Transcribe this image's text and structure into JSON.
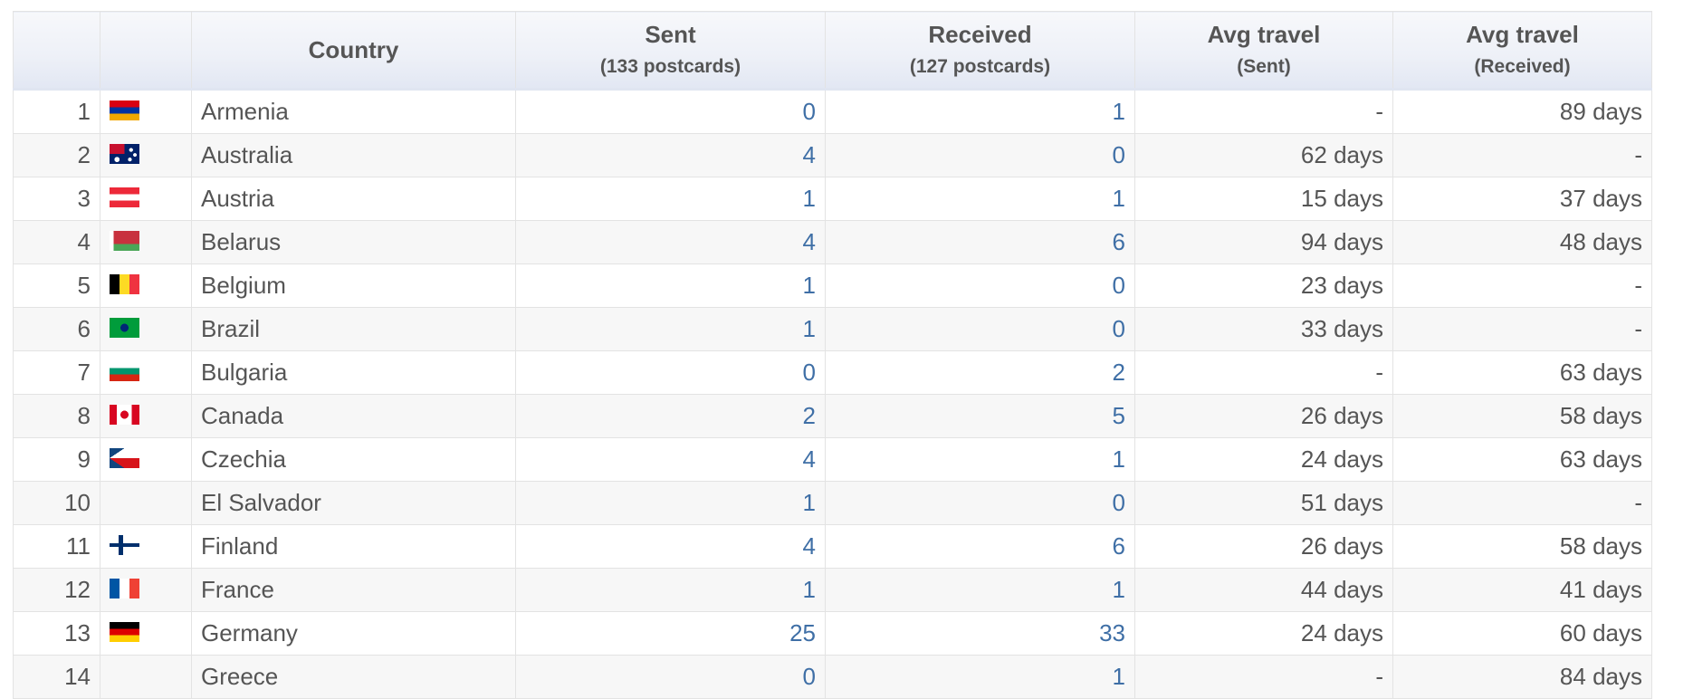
{
  "table": {
    "headers": {
      "country": "Country",
      "sent": "Sent",
      "sent_sub": "(133 postcards)",
      "received": "Received",
      "received_sub": "(127 postcards)",
      "avg_sent": "Avg travel",
      "avg_sent_sub": "(Sent)",
      "avg_received": "Avg travel",
      "avg_received_sub": "(Received)"
    },
    "rows": [
      {
        "rank": "1",
        "flag": "flag-armenia-icon",
        "country": "Armenia",
        "sent": "0",
        "received": "1",
        "avg_sent": "-",
        "avg_received": "89 days"
      },
      {
        "rank": "2",
        "flag": "flag-australia-icon",
        "country": "Australia",
        "sent": "4",
        "received": "0",
        "avg_sent": "62 days",
        "avg_received": "-"
      },
      {
        "rank": "3",
        "flag": "flag-austria-icon",
        "country": "Austria",
        "sent": "1",
        "received": "1",
        "avg_sent": "15 days",
        "avg_received": "37 days"
      },
      {
        "rank": "4",
        "flag": "flag-belarus-icon",
        "country": "Belarus",
        "sent": "4",
        "received": "6",
        "avg_sent": "94 days",
        "avg_received": "48 days"
      },
      {
        "rank": "5",
        "flag": "flag-belgium-icon",
        "country": "Belgium",
        "sent": "1",
        "received": "0",
        "avg_sent": "23 days",
        "avg_received": "-"
      },
      {
        "rank": "6",
        "flag": "flag-brazil-icon",
        "country": "Brazil",
        "sent": "1",
        "received": "0",
        "avg_sent": "33 days",
        "avg_received": "-"
      },
      {
        "rank": "7",
        "flag": "flag-bulgaria-icon",
        "country": "Bulgaria",
        "sent": "0",
        "received": "2",
        "avg_sent": "-",
        "avg_received": "63 days"
      },
      {
        "rank": "8",
        "flag": "flag-canada-icon",
        "country": "Canada",
        "sent": "2",
        "received": "5",
        "avg_sent": "26 days",
        "avg_received": "58 days"
      },
      {
        "rank": "9",
        "flag": "flag-czechia-icon",
        "country": "Czechia",
        "sent": "4",
        "received": "1",
        "avg_sent": "24 days",
        "avg_received": "63 days"
      },
      {
        "rank": "10",
        "flag": "",
        "country": "El Salvador",
        "sent": "1",
        "received": "0",
        "avg_sent": "51 days",
        "avg_received": "-"
      },
      {
        "rank": "11",
        "flag": "flag-finland-icon",
        "country": "Finland",
        "sent": "4",
        "received": "6",
        "avg_sent": "26 days",
        "avg_received": "58 days"
      },
      {
        "rank": "12",
        "flag": "flag-france-icon",
        "country": "France",
        "sent": "1",
        "received": "1",
        "avg_sent": "44 days",
        "avg_received": "41 days"
      },
      {
        "rank": "13",
        "flag": "flag-germany-icon",
        "country": "Germany",
        "sent": "25",
        "received": "33",
        "avg_sent": "24 days",
        "avg_received": "60 days"
      },
      {
        "rank": "14",
        "flag": "",
        "country": "Greece",
        "sent": "0",
        "received": "1",
        "avg_sent": "-",
        "avg_received": "84 days"
      }
    ]
  },
  "colors": {
    "link": "#3f6fa6",
    "text": "#555555",
    "header_bg": "#edf0f7",
    "stripe": "#f7f7f7"
  }
}
